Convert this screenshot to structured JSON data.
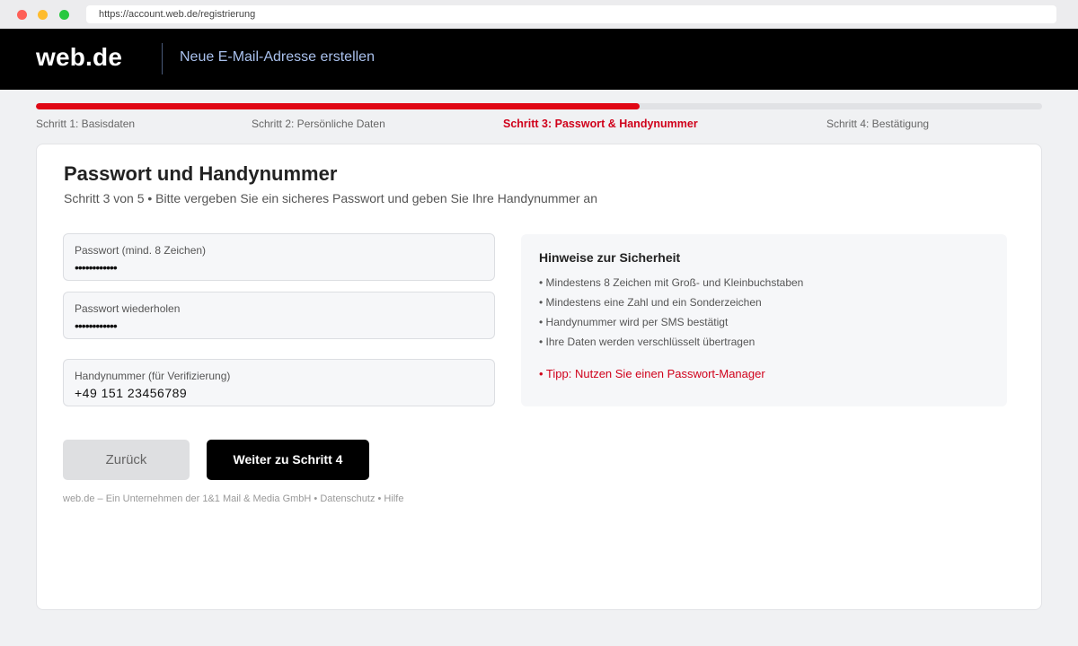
{
  "browser": {
    "url": "https://account.web.de/registrierung"
  },
  "header": {
    "logo": "web.de",
    "title": "Neue E-Mail-Adresse erstellen"
  },
  "progress": {
    "fraction": 0.6,
    "steps": [
      "Schritt 1: Basisdaten",
      "Schritt 2: Persönliche Daten",
      "Schritt 3: Passwort & Handynummer",
      "Schritt 4: Bestätigung"
    ],
    "active_index": 2
  },
  "form": {
    "title": "Passwort und Handynummer",
    "subtitle": "Schritt 3 von 5 • Bitte vergeben Sie ein sicheres Passwort und geben Sie Ihre Handynummer an",
    "password": {
      "label": "Passwort (mind. 8 Zeichen)",
      "value": "••••••••••••"
    },
    "password_repeat": {
      "label": "Passwort wiederholen",
      "value": "••••••••••••"
    },
    "phone": {
      "label": "Handynummer (für Verifizierung)",
      "value": "+49 151 23456789"
    }
  },
  "hints": {
    "title": "Hinweise zur Sicherheit",
    "items": [
      "• Mindestens 8 Zeichen mit Groß- und Kleinbuchstaben",
      "• Mindestens eine Zahl und ein Sonderzeichen",
      "• Handynummer wird per SMS bestätigt",
      "• Ihre Daten werden verschlüsselt übertragen"
    ],
    "tip": "• Tipp: Nutzen Sie einen Passwort-Manager"
  },
  "actions": {
    "back_label": "Zurück",
    "next_label": "Weiter zu Schritt 4"
  },
  "footer": {
    "text": "web.de – Ein Unternehmen der 1&1 Mail & Media GmbH • Datenschutz • Hilfe"
  },
  "colors": {
    "accent": "#e00714",
    "active_step": "#d0021b",
    "header_bg": "#000000",
    "header_title": "#a9c0ec"
  }
}
